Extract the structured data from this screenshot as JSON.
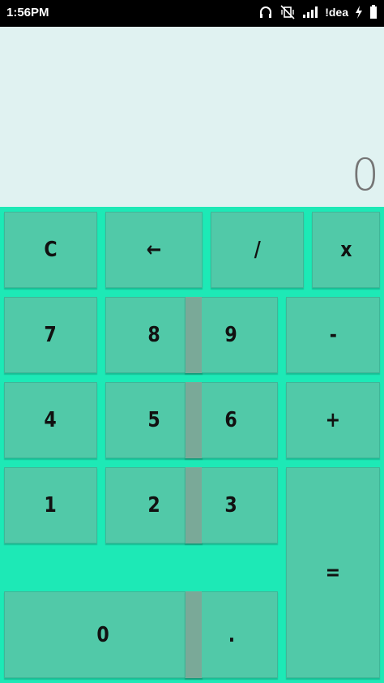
{
  "status_bar": {
    "time": "1:56PM",
    "carrier": "!dea",
    "icons": [
      "headphones-icon",
      "vibrate-off-icon",
      "signal-icon",
      "charging-icon"
    ]
  },
  "display": {
    "value": "0"
  },
  "keys": {
    "clear": "C",
    "backspace": "←",
    "divide": "/",
    "multiply": "x",
    "seven": "7",
    "eight": "8",
    "nine": "9",
    "minus": "-",
    "four": "4",
    "five": "5",
    "six": "6",
    "plus": "+",
    "one": "1",
    "two": "2",
    "three": "3",
    "equals": "=",
    "zero": "0",
    "decimal": "."
  },
  "colors": {
    "background": "#1de9b6",
    "key": "#51c9a8",
    "display": "#e0f2f1",
    "divider": "#7aa998",
    "status_bar": "#000000"
  }
}
